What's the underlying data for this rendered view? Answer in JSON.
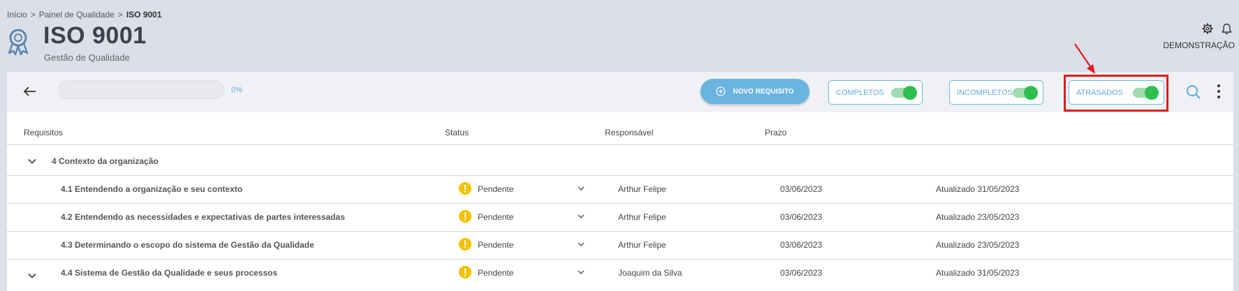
{
  "breadcrumb": {
    "home": "Início",
    "sep": ">",
    "parent": "Painel de Qualidade",
    "current": "ISO 9001"
  },
  "page": {
    "title": "ISO 9001",
    "title_dot": ".",
    "subtitle": "Gestão de Qualidade"
  },
  "header": {
    "user": "DEMONSTRAÇÃO",
    "icons": [
      "gear-icon",
      "bell-icon"
    ]
  },
  "toolbar": {
    "progress": {
      "value": 0,
      "label": "0%"
    },
    "new_button": "NOVO REQUISITO",
    "filters": [
      {
        "label": "COMPLETOS",
        "on": true
      },
      {
        "label": "INCOMPLETOS",
        "on": true
      },
      {
        "label": "ATRASADOS",
        "on": true
      }
    ],
    "icons": [
      "back-arrow-icon",
      "search-icon",
      "more-vertical-icon"
    ]
  },
  "table": {
    "columns": [
      "Requisitos",
      "Status",
      "Responsável",
      "Prazo"
    ],
    "group": "4 Contexto da organização",
    "rows": [
      {
        "title": "4.1 Entendendo a organização e seu contexto",
        "status": "Pendente",
        "owner": "Arthur Felipe",
        "due": "03/06/2023",
        "updated": "Atualizado 31/05/2023"
      },
      {
        "title": "4.2 Entendendo as necessidades e expectativas de partes interessadas",
        "status": "Pendente",
        "owner": "Arthur Felipe",
        "due": "03/06/2023",
        "updated": "Atualizado 23/05/2023"
      },
      {
        "title": "4.3 Determinando o escopo do sistema de Gestão da Qualidade",
        "status": "Pendente",
        "owner": "Arthur Felipe",
        "due": "03/06/2023",
        "updated": "Atualizado 23/05/2023"
      },
      {
        "title": "4.4 Sistema de Gestão da Qualidade e seus processos",
        "status": "Pendente",
        "owner": "Joaquim da Silva",
        "due": "03/06/2023",
        "updated": "Atualizado 31/05/2023"
      }
    ]
  },
  "colors": {
    "accent": "#6ab4e2",
    "toggle_on": "#2fbf4f",
    "warning": "#f2c200",
    "annotation": "#e01c1c",
    "title": "#3a4250"
  }
}
